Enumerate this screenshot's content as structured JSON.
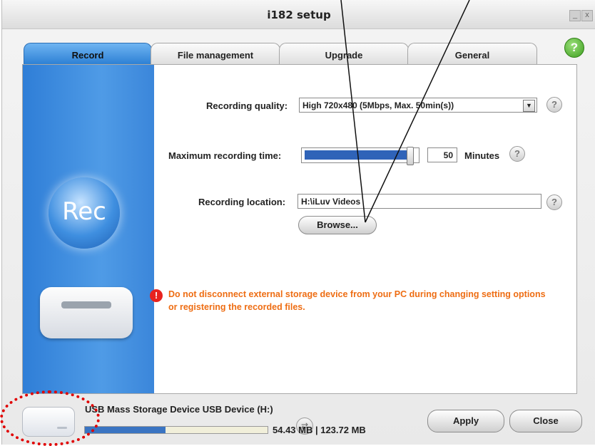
{
  "window": {
    "title": "i182 setup",
    "minimize_label": "_",
    "close_label": "x",
    "help_label": "?"
  },
  "tabs": [
    {
      "label": "Record",
      "active": true
    },
    {
      "label": "File management",
      "active": false
    },
    {
      "label": "Upgrade",
      "active": false
    },
    {
      "label": "General",
      "active": false
    }
  ],
  "sidebar": {
    "rec_label": "Rec"
  },
  "form": {
    "quality_label": "Recording quality:",
    "quality_value": "High 720x480 (5Mbps, Max. 50min(s))",
    "max_time_label": "Maximum recording time:",
    "max_time_value": "50",
    "max_time_fraction": 0.98,
    "max_time_unit": "Minutes",
    "location_label": "Recording location:",
    "location_value": "H:\\iLuv Videos",
    "browse_label": "Browse...",
    "help_label": "?"
  },
  "warning": {
    "icon_label": "!",
    "text": "Do not disconnect external storage device from your PC during changing setting options or registering the recorded files."
  },
  "footer": {
    "device_name": "USB Mass Storage Device USB Device (H:)",
    "usage_text": "54.43 MB | 123.72 MB",
    "usage_fraction": 0.44,
    "apply_label": "Apply",
    "close_label": "Close"
  },
  "colors": {
    "accent_blue": "#2b7fd4",
    "warning_orange": "#ee6d13",
    "annotation_red": "#e00000"
  }
}
